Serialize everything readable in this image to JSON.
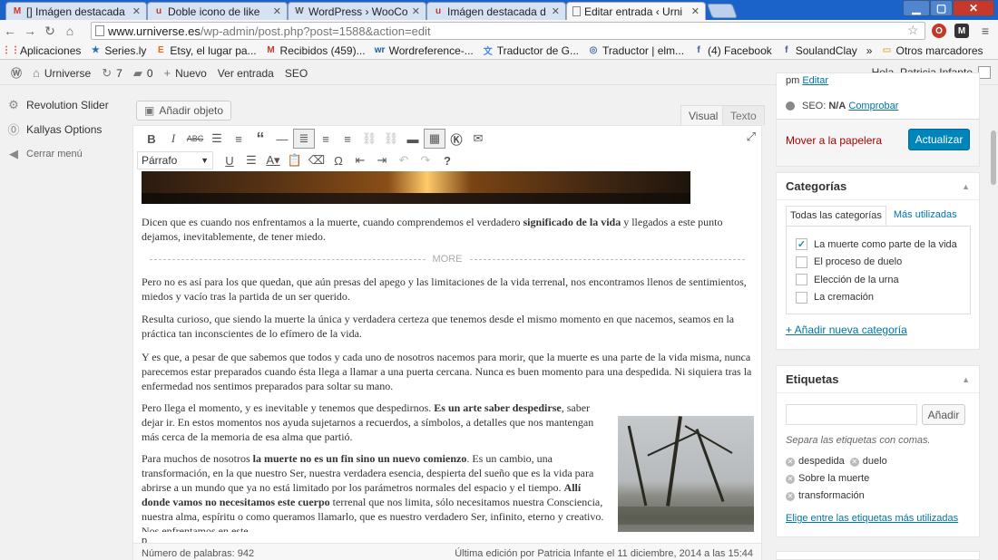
{
  "browser": {
    "tabs": [
      {
        "label": "[] Imágen destacada",
        "icon": "M",
        "icon_color": "#d93025"
      },
      {
        "label": "Doble icono de like",
        "icon": "u",
        "icon_color": "#c0392b"
      },
      {
        "label": "WordPress › WooCo",
        "icon": "W",
        "icon_color": "#555555"
      },
      {
        "label": "Imágen destacada d",
        "icon": "u",
        "icon_color": "#c0392b"
      },
      {
        "label": "Editar entrada ‹ Urni",
        "icon": "",
        "icon_color": "#888888"
      }
    ],
    "url_host": "www.urniverse.es",
    "url_path": "/wp-admin/post.php?post=1588&action=edit",
    "bookmarks": [
      {
        "label": "Aplicaciones",
        "icon": "apps-icon",
        "glyph": "⋮⋮",
        "color": "#d93025"
      },
      {
        "label": "Series.ly",
        "icon": "seriesly-icon",
        "glyph": "★",
        "color": "#2a6fb5"
      },
      {
        "label": "Etsy, el lugar pa...",
        "icon": "etsy-icon",
        "glyph": "E",
        "color": "#f1641e"
      },
      {
        "label": "Recibidos (459)...",
        "icon": "gmail-icon",
        "glyph": "M",
        "color": "#d93025"
      },
      {
        "label": "Wordreference-...",
        "icon": "wordreference-icon",
        "glyph": "wr",
        "color": "#1a5ea8"
      },
      {
        "label": "Traductor de G...",
        "icon": "translate-icon",
        "glyph": "文",
        "color": "#4285f4"
      },
      {
        "label": "Traductor | elm...",
        "icon": "translate2-icon",
        "glyph": "◎",
        "color": "#4a6ea8"
      },
      {
        "label": "(4) Facebook",
        "icon": "facebook-icon",
        "glyph": "f",
        "color": "#3b5998"
      },
      {
        "label": "SoulandClay",
        "icon": "facebook2-icon",
        "glyph": "f",
        "color": "#3b5998"
      }
    ],
    "more_bookmarks": "»",
    "other_bookmarks": "Otros marcadores"
  },
  "adminbar": {
    "site_name": "Urniverse",
    "updates_count": "7",
    "comments_count": "0",
    "new_label": "Nuevo",
    "view_label": "Ver entrada",
    "seo_label": "SEO",
    "greeting": "Hola, Patricia Infante"
  },
  "sidemenu": [
    {
      "label": "Revolution Slider",
      "icon": "gear-icon"
    },
    {
      "label": "Kallyas Options",
      "icon": "kallyas-icon"
    },
    {
      "label": "Cerrar menú",
      "icon": "collapse-icon"
    }
  ],
  "editor": {
    "add_media": "Añadir objeto",
    "tab_visual": "Visual",
    "tab_text": "Texto",
    "format_select": "Párrafo",
    "paragraphs": [
      {
        "parts": [
          {
            "t": "Dicen que es cuando nos enfrentamos a la muerte, cuando  comprendemos el verdadero ",
            "b": false
          },
          {
            "t": "significado de la vida",
            "b": true
          },
          {
            "t": " y llegados a este punto dejamos, inevitablemente, de tener miedo.",
            "b": false
          }
        ]
      },
      {
        "parts": [
          {
            "t": "Pero no es así para los que quedan, que aún presas del apego y las limitaciones de la vida terrenal, nos encontramos llenos de sentimientos, miedos y vacío tras la partida de un ser querido.",
            "b": false
          }
        ]
      },
      {
        "parts": [
          {
            "t": "Resulta curioso, que siendo la muerte la única y verdadera certeza que tenemos desde el mismo momento en que nacemos, seamos en la práctica tan inconscientes de lo efímero de la vida.",
            "b": false
          }
        ]
      },
      {
        "parts": [
          {
            "t": "Y es que, a pesar de que sabemos que todos y cada uno de nosotros nacemos para morir, que la muerte es una parte de la vida misma, nunca parecemos estar preparados cuando ésta llega a llamar a una puerta cercana. Nunca es buen momento para una despedida. Ni siquiera tras la enfermedad nos sentimos preparados para soltar su mano.",
            "b": false
          }
        ]
      },
      {
        "parts": [
          {
            "t": "Pero llega el momento, y es inevitable y tenemos que despedirnos. ",
            "b": false
          },
          {
            "t": "Es un arte saber despedirse",
            "b": true
          },
          {
            "t": ", saber dejar ir. En estos momentos nos ayuda sujetarnos a recuerdos, a símbolos, a detalles que nos mantengan más cerca de la memoria de esa alma que partió.",
            "b": false
          }
        ]
      },
      {
        "parts": [
          {
            "t": "Para muchos de nosotros ",
            "b": false
          },
          {
            "t": "la muerte no es un fin sino un nuevo comienzo",
            "b": true
          },
          {
            "t": ". Es un cambio, una transformación, en la que nuestro Ser, nuestra verdadera esencia, despierta del sueño que es la vida para abrirse a un mundo que ya no está limitado por los parámetros normales del espacio y el tiempo. ",
            "b": false
          },
          {
            "t": "Allí donde vamos no necesitamos este cuerpo",
            "b": true
          },
          {
            "t": " terrenal que nos limita, sólo necesitamos nuestra Consciencia, nuestra alma, espíritu o como queramos llamarlo, que es nuestro verdadero Ser, infinito, eterno y creativo. Nos enfrentamos en este",
            "b": false
          }
        ]
      }
    ],
    "more_tag": "MORE",
    "path_tag": "p",
    "word_count": "Número de palabras: 942",
    "last_edit": "Última edición por Patricia Infante el 11 diciembre, 2014 a las 15:44"
  },
  "publish": {
    "partial_label": "pm",
    "partial_link": "Editar",
    "seo_label": "SEO:",
    "seo_value": "N/A",
    "seo_check": "Comprobar",
    "trash": "Mover a la papelera",
    "update": "Actualizar"
  },
  "categories": {
    "title": "Categorías",
    "tab_all": "Todas las categorías",
    "tab_most": "Más utilizadas",
    "items": [
      {
        "label": "La muerte como parte de la vida",
        "checked": true
      },
      {
        "label": "El proceso de duelo",
        "checked": false
      },
      {
        "label": "Elección de la urna",
        "checked": false
      },
      {
        "label": "La cremación",
        "checked": false
      }
    ],
    "add_new": "+ Añadir nueva categoría"
  },
  "tags": {
    "title": "Etiquetas",
    "add_button": "Añadir",
    "hint": "Separa las etiquetas con comas.",
    "items": [
      "despedida",
      "duelo",
      "Sobre la muerte",
      "transformación"
    ],
    "most_used": "Elige entre las etiquetas más utilizadas"
  }
}
